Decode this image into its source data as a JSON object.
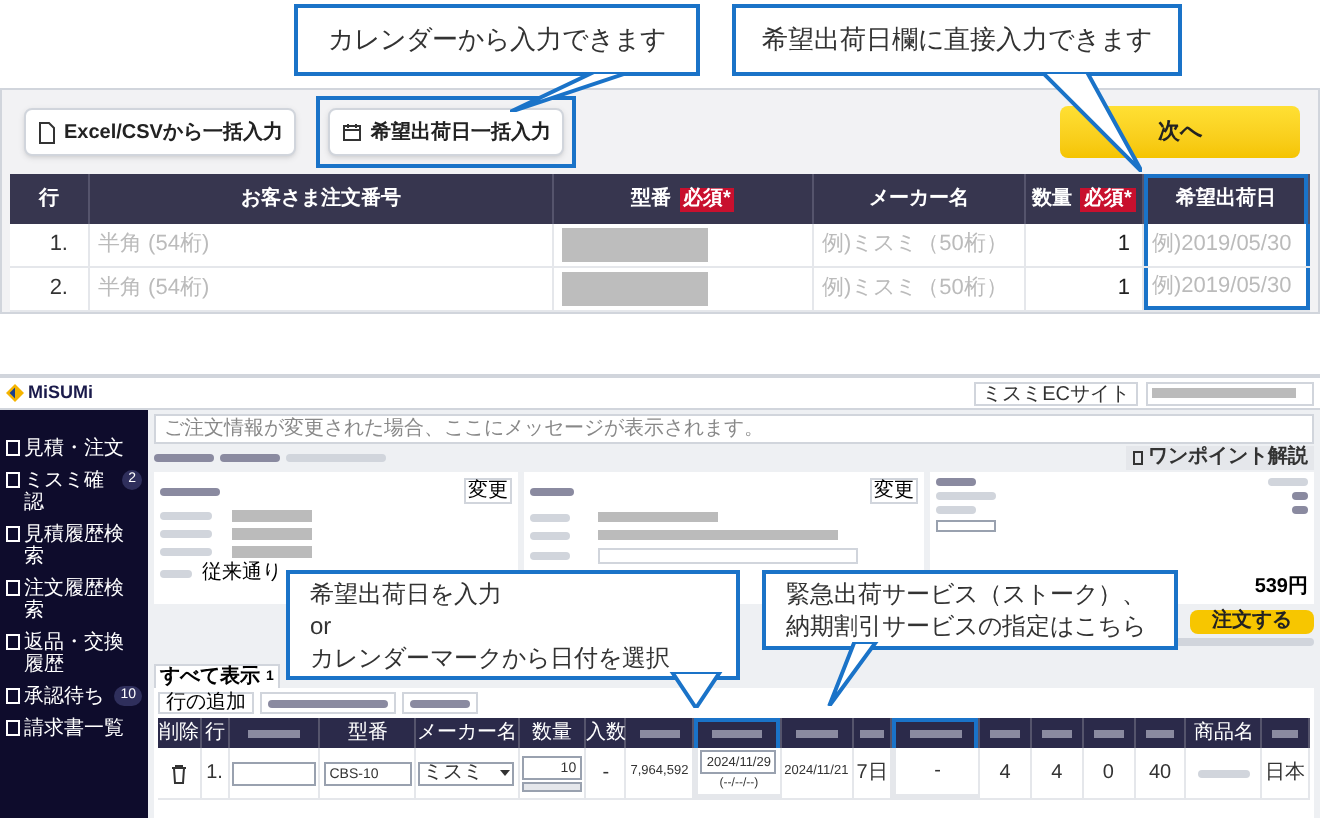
{
  "top_callouts": [
    {
      "text": "カレンダーから入力できます"
    },
    {
      "text": "希望出荷日欄に直接入力できます"
    }
  ],
  "order_form": {
    "toolbar_buttons": [
      {
        "kind": "file",
        "label": "Excel/CSVから一括入力",
        "highlighted": false
      },
      {
        "kind": "calendar",
        "label": "希望出荷日一括入力",
        "highlighted": true
      }
    ],
    "next_button": "次へ",
    "columns": [
      {
        "label": "行"
      },
      {
        "label": "お客さま注文番号"
      },
      {
        "label": "型番",
        "required": "必須*"
      },
      {
        "label": "メーカー名"
      },
      {
        "label": "数量",
        "required": "必須*"
      },
      {
        "label": "希望出荷日",
        "highlighted": true
      }
    ],
    "rows": [
      {
        "number": "1.",
        "order_number_placeholder": "半角 (54桁)",
        "maker_placeholder": "例)ミスミ（50桁）",
        "quantity": "1",
        "date_placeholder": "例)2019/05/30"
      },
      {
        "number": "2.",
        "order_number_placeholder": "半角 (54桁)",
        "maker_placeholder": "例)ミスミ（50桁）",
        "quantity": "1",
        "date_placeholder": "例)2019/05/30"
      }
    ]
  },
  "app": {
    "logo": "MiSUMi",
    "site_button": "ミスミECサイト",
    "message": "ご注文情報が変更された場合、ここにメッセージが表示されます。",
    "sidebar": [
      {
        "label": "見積・注文"
      },
      {
        "label": "ミスミ確認",
        "badge": "2"
      },
      {
        "label": "見積履歴検索"
      },
      {
        "label": "注文履歴検索"
      },
      {
        "label": "返品・交換履歴"
      },
      {
        "label": "承認待ち",
        "badge": "10"
      },
      {
        "label": "請求書一覧"
      }
    ],
    "guide_button": "ワンポイント解説",
    "buyer_panel": {
      "change_button": "変更",
      "payment": "従来通り"
    },
    "delivery_panel": {
      "change_button": "変更"
    },
    "total_panel": {
      "total": "539円"
    },
    "order_button": "注文する",
    "tabs": [
      {
        "label": "すべて表示",
        "count": "1",
        "selected": true
      }
    ],
    "actions": [
      {
        "label": "行の追加"
      },
      {
        "kind": "blurred"
      },
      {
        "kind": "blurred"
      }
    ],
    "table": {
      "headers": [
        {
          "kind": "text",
          "label": "削除"
        },
        {
          "kind": "text",
          "label": "行"
        },
        {
          "kind": "blurred"
        },
        {
          "kind": "text",
          "label": "型番"
        },
        {
          "kind": "text",
          "label": "メーカー名"
        },
        {
          "kind": "text",
          "label": "数量"
        },
        {
          "kind": "text",
          "label": "入数"
        },
        {
          "kind": "blurred"
        },
        {
          "kind": "blurred",
          "highlighted": true
        },
        {
          "kind": "blurred"
        },
        {
          "kind": "blurred"
        },
        {
          "kind": "blurred",
          "highlighted": true
        },
        {
          "kind": "blurred"
        },
        {
          "kind": "blurred"
        },
        {
          "kind": "blurred"
        },
        {
          "kind": "blurred"
        },
        {
          "kind": "text",
          "label": "商品名"
        },
        {
          "kind": "blurred"
        }
      ],
      "row": [
        {
          "kind": "delete"
        },
        {
          "kind": "text",
          "text": "1."
        },
        {
          "kind": "input"
        },
        {
          "kind": "input",
          "value": "CBS-10"
        },
        {
          "kind": "select",
          "value": "ミスミ"
        },
        {
          "kind": "quantity",
          "value": "10"
        },
        {
          "kind": "text",
          "text": "-"
        },
        {
          "kind": "text",
          "text": "7,964,592"
        },
        {
          "kind": "date",
          "value": "2024/11/29",
          "sub": "(--/--/--)"
        },
        {
          "kind": "text",
          "text": "2024/11/21"
        },
        {
          "kind": "text",
          "text": "7日"
        },
        {
          "kind": "text",
          "text": "-"
        },
        {
          "kind": "text",
          "text": "4"
        },
        {
          "kind": "text",
          "text": "4"
        },
        {
          "kind": "text",
          "text": "0"
        },
        {
          "kind": "text",
          "text": "40"
        },
        {
          "kind": "blurred"
        },
        {
          "kind": "text",
          "text": "日本"
        }
      ]
    },
    "callouts": [
      {
        "lines": [
          "希望出荷日を入力",
          "or",
          "カレンダーマークから日付を選択"
        ]
      },
      {
        "lines": [
          "緊急出荷サービス（ストーク）、",
          "納期割引サービスの指定はこちら"
        ]
      }
    ]
  }
}
